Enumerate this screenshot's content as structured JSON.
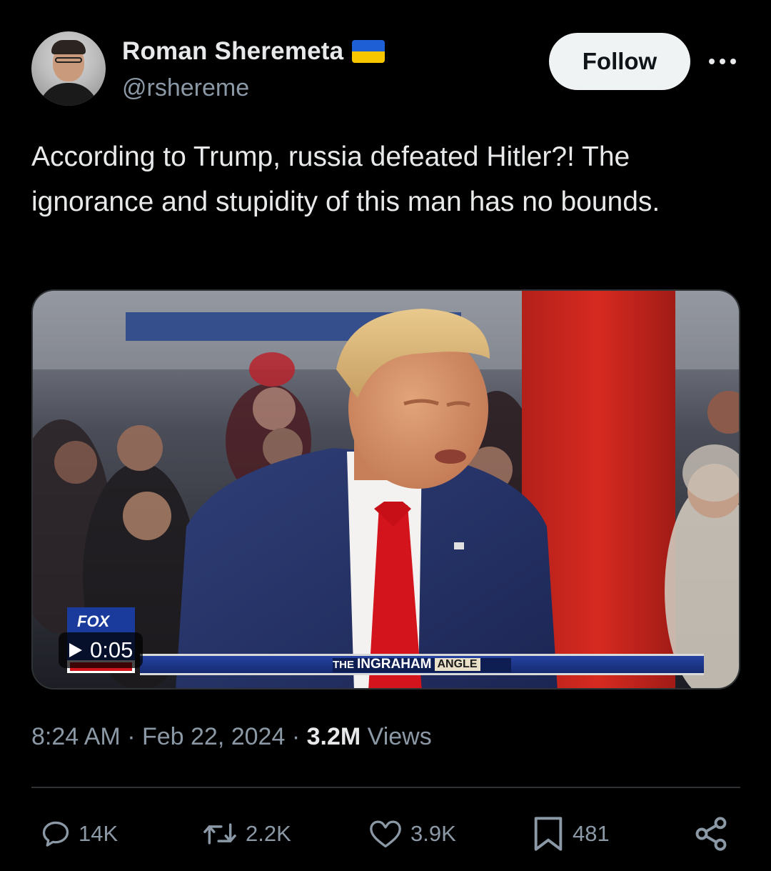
{
  "author": {
    "display_name": "Roman Sheremeta",
    "handle": "@rshereme",
    "flag_colors": {
      "top": "#1f5fd6",
      "bottom": "#f7c600"
    }
  },
  "follow_label": "Follow",
  "tweet_text": "According to Trump, russia defeated Hitler?! The ignorance and stupidity of this man has no bounds.",
  "media": {
    "duration": "0:05",
    "chyron_show_prefix": "THE",
    "chyron_show_name": "INGRAHAM",
    "chyron_show_suffix": "ANGLE",
    "network_logo_text": "FOX"
  },
  "meta": {
    "time": "8:24 AM",
    "separator": "·",
    "date": "Feb 22, 2024",
    "views_count": "3.2M",
    "views_label": "Views"
  },
  "actions": {
    "replies": "14K",
    "reposts": "2.2K",
    "likes": "3.9K",
    "bookmarks": "481"
  },
  "colors": {
    "background": "#000000",
    "text_primary": "#e7e9ea",
    "text_secondary": "#8b98a5",
    "divider": "#2f3336",
    "follow_bg": "#eff3f4"
  }
}
